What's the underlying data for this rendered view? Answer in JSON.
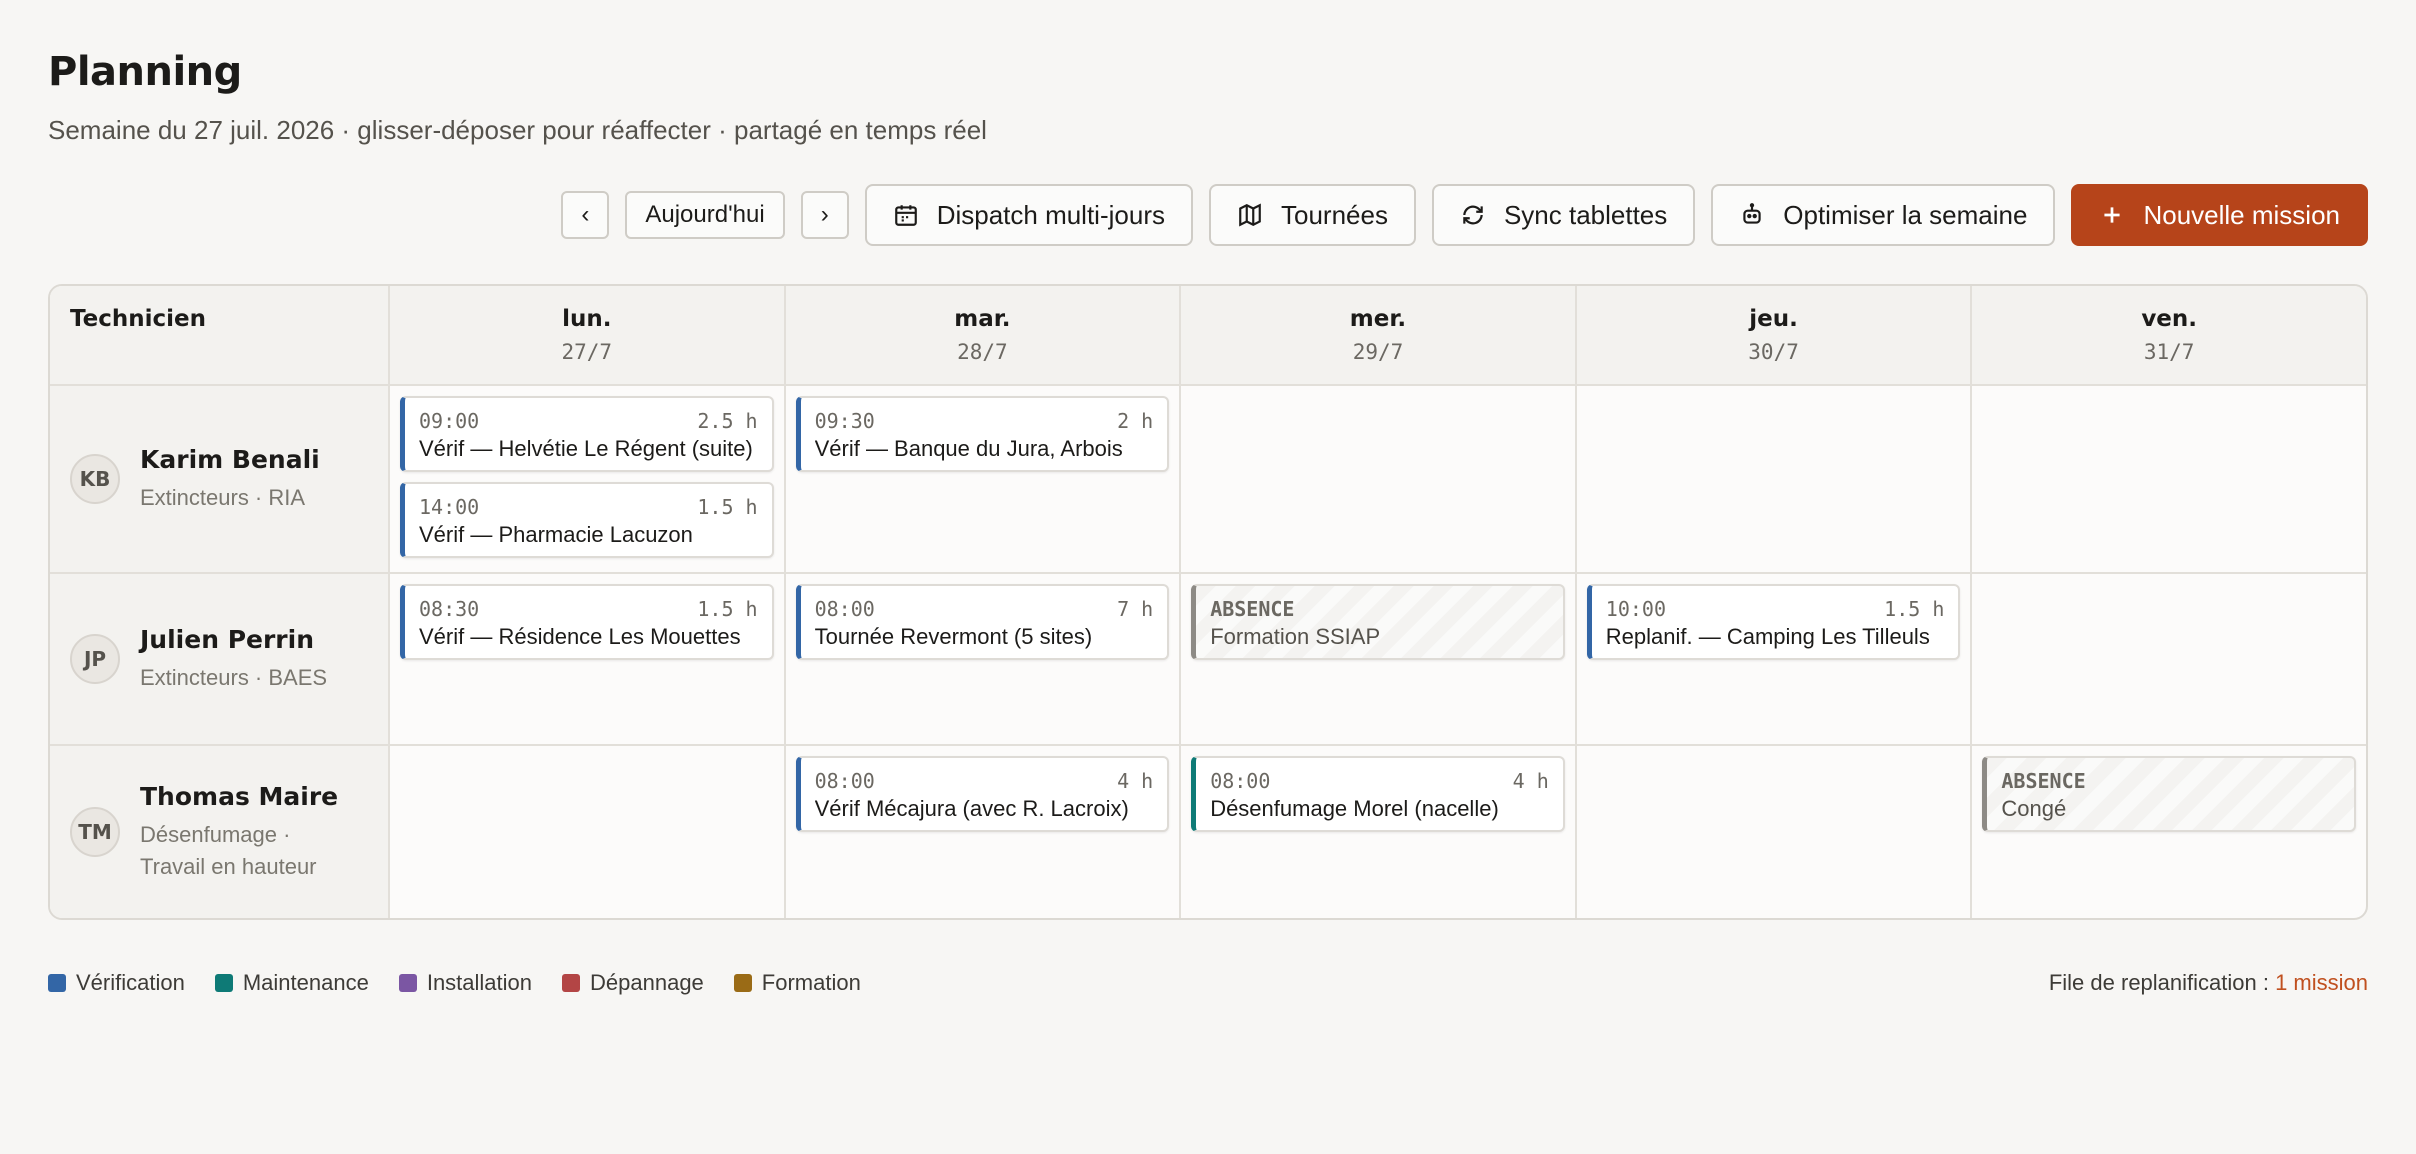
{
  "header": {
    "title": "Planning",
    "subtitle": "Semaine du 27 juil. 2026 · glisser-déposer pour réaffecter · partagé en temps réel"
  },
  "toolbar": {
    "prev_label": "‹",
    "today_label": "Aujourd'hui",
    "next_label": "›",
    "dispatch_label": "Dispatch multi-jours",
    "tours_label": "Tournées",
    "sync_label": "Sync tablettes",
    "optimize_label": "Optimiser la semaine",
    "new_label": "Nouvelle mission"
  },
  "grid": {
    "tech_header": "Technicien",
    "days": [
      {
        "name": "lun.",
        "date": "27/7"
      },
      {
        "name": "mar.",
        "date": "28/7"
      },
      {
        "name": "mer.",
        "date": "29/7"
      },
      {
        "name": "jeu.",
        "date": "30/7"
      },
      {
        "name": "ven.",
        "date": "31/7"
      }
    ],
    "technicians": [
      {
        "initials": "KB",
        "name": "Karim Benali",
        "skills": "Extincteurs · RIA",
        "missions": [
          [
            {
              "time": "09:00",
              "duration": "2.5 h",
              "title": "Vérif — Helvétie Le Régent (suite)"
            },
            {
              "time": "14:00",
              "duration": "1.5 h",
              "title": "Vérif — Pharmacie Lacuzon"
            }
          ],
          [
            {
              "time": "09:30",
              "duration": "2 h",
              "title": "Vérif — Banque du Jura, Arbois"
            }
          ]
        ]
      },
      {
        "initials": "JP",
        "name": "Julien Perrin",
        "skills": "Extincteurs · BAES",
        "missions": [
          [
            {
              "time": "08:30",
              "duration": "1.5 h",
              "title": "Vérif — Résidence Les Mouettes"
            }
          ],
          [
            {
              "time": "08:00",
              "duration": "7 h",
              "title": "Tournée Revermont (5 sites)"
            }
          ],
          [
            {
              "tag": "ABSENCE",
              "title": "Formation SSIAP"
            }
          ],
          [
            {
              "time": "10:00",
              "duration": "1.5 h",
              "title": "Replanif. — Camping Les Tilleuls"
            }
          ]
        ]
      },
      {
        "initials": "TM",
        "name": "Thomas Maire",
        "skills": "Désenfumage · Travail en hauteur",
        "missions": [
          [
            {
              "time": "08:00",
              "duration": "4 h",
              "title": "Vérif Mécajura (avec R. Lacroix)"
            }
          ],
          [
            {
              "time": "08:00",
              "duration": "4 h",
              "title": "Désenfumage Morel (nacelle)"
            }
          ],
          [
            {
              "tag": "ABSENCE",
              "title": "Congé"
            }
          ]
        ]
      }
    ]
  },
  "legend": [
    {
      "label": "Vérification",
      "color": "#3366a6"
    },
    {
      "label": "Maintenance",
      "color": "#0e7a76"
    },
    {
      "label": "Installation",
      "color": "#7b56a3"
    },
    {
      "label": "Dépannage",
      "color": "#b34545"
    },
    {
      "label": "Formation",
      "color": "#9a6b16"
    }
  ],
  "queue": {
    "label": "File de replanification : ",
    "count": "1 mission"
  },
  "colors": {
    "accent": "#b6441a",
    "verification": "#3366a6",
    "maintenance": "#0e7a76"
  }
}
